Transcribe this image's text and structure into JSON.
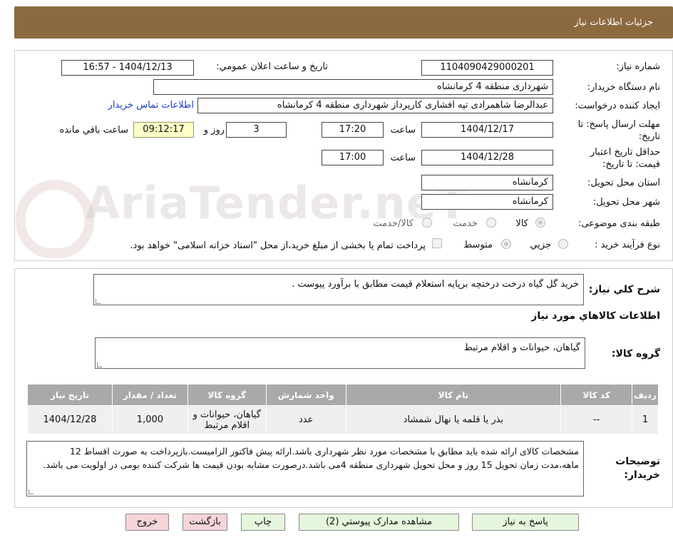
{
  "header": {
    "title": "جزئيات اطلاعات نياز"
  },
  "watermark": {
    "text": "AriaTender.neT"
  },
  "form": {
    "need_number_label": "شماره نياز:",
    "need_number": "1104090429000201",
    "announce_label": "تاريخ و ساعت اعلان عمومي:",
    "announce_value": "1404/12/13 - 16:57",
    "buyer_org_label": "نام دستگاه خريدار:",
    "buyer_org": "شهرداری منطقه 4 کرمانشاه",
    "requester_label": "ايجاد کننده درخواست:",
    "requester": "عبدالرضا شاهمرادی تپه افشاری کارپرداز شهرداری منطقه 4 کرمانشاه",
    "contact_link": "اطلاعات تماس خريدار",
    "deadline_label_1": "مهلت ارسال پاسخ: تا",
    "deadline_label_2": "تاريخ:",
    "deadline_date": "1404/12/17",
    "time_label": "ساعت",
    "deadline_time": "17:20",
    "days_value": "3",
    "days_label": "روز و",
    "remaining_time": "09:12:17",
    "remaining_label": "ساعت باقي مانده",
    "validity_label_1": "حداقل تاريخ اعتبار",
    "validity_label_2": "قيمت: تا تاريخ:",
    "validity_date": "1404/12/28",
    "validity_time_label": "ساعت",
    "validity_time": "17:00",
    "province_label": "استان محل تحويل:",
    "province": "کرمانشاه",
    "city_label": "شهر محل تحويل:",
    "city": "کرمانشاه",
    "category_label": "طبقه بندی موضوعی:",
    "category_options": [
      "کالا",
      "خدمت",
      "کالا/خدمت"
    ],
    "process_label": "نوع فرآيند خريد :",
    "process_options": [
      "جزيي",
      "متوسط"
    ],
    "payment_note": "پرداخت تمام يا بخشی از مبلغ خريد،از محل \"اسناد خزانه اسلامی\" خواهد بود."
  },
  "description": {
    "label": "شرح کلي نياز:",
    "text": "خرید گل گیاه درخت درختچه برپایه استعلام قیمت مطابق با برآورد پیوست ."
  },
  "goods_section": {
    "title": "اطلاعات کالاهاي مورد نياز",
    "group_label": "گروه کالا:",
    "group_value": "گیاهان، حیوانات و اقلام مرتبط"
  },
  "table": {
    "headers": [
      "رديف",
      "کد کالا",
      "نام کالا",
      "واحد شمارش",
      "گروه کالا",
      "تعداد / مقدار",
      "تاريخ نياز"
    ],
    "rows": [
      [
        "1",
        "--",
        "بذر یا قلمه یا نهال شمشاد",
        "عدد",
        "گیاهان، حیوانات و اقلام مرتبط",
        "1,000",
        "1404/12/28"
      ]
    ]
  },
  "buyer_notes": {
    "label_1": "توضيحات",
    "label_2": "خريدار:",
    "text": "مشخصات کالای ارائه شده باید مطابق با مشخصات مورد نظر شهرداری باشد.ارائه پیش فاکتور الزامیست.بازپرداخت به صورت اقساط 12 ماهه،مدت زمان تحویل 15 روز و محل تحویل شهرداری منطقه 4می باشد.درصورت مشابه بودن قیمت ها شرکت کننده بومی در اولویت می باشد."
  },
  "buttons": {
    "reply": "پاسخ به نياز",
    "attachments": "مشاهده مدارک پيوستي (2)",
    "print": "چاپ",
    "back": "بازگشت",
    "exit": "خروج"
  },
  "colors": {
    "header_bg": "#8b6a3f",
    "table_header_bg": "#a9a9a9",
    "link": "#1a3cc8",
    "timer_bg": "#ffffc8"
  }
}
